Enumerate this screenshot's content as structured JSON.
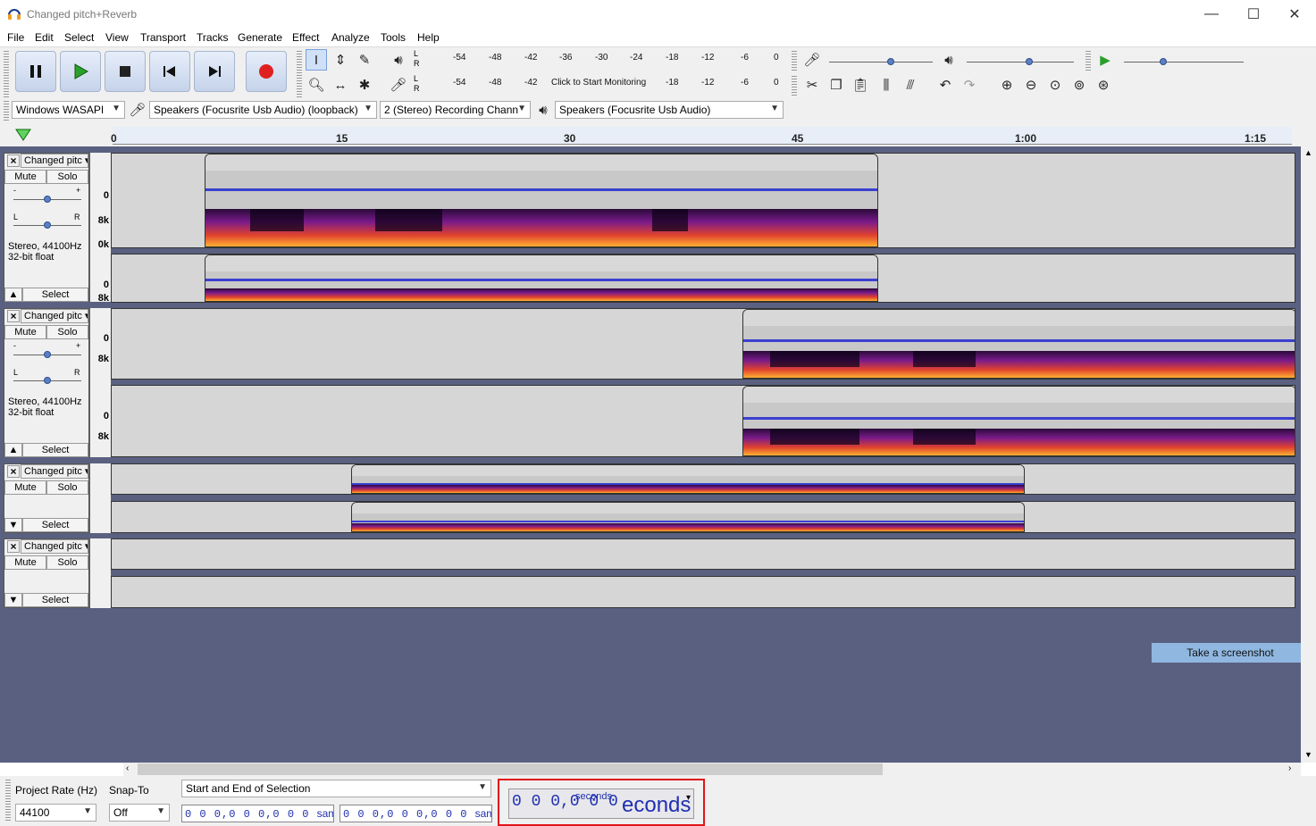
{
  "window": {
    "title": "Changed pitch+Reverb",
    "min": "—",
    "max": "☐",
    "close": "✕"
  },
  "menu": [
    "File",
    "Edit",
    "Select",
    "View",
    "Transport",
    "Tracks",
    "Generate",
    "Effect",
    "Analyze",
    "Tools",
    "Help"
  ],
  "meters": {
    "record_scale": [
      "-54",
      "-48",
      "-42",
      "-36",
      "-30",
      "-24",
      "-18",
      "-12",
      "-6",
      "0"
    ],
    "play_scale": [
      "-54",
      "-48",
      "-42",
      "Click to Start Monitoring",
      "-18",
      "-12",
      "-6",
      "0"
    ],
    "lr": [
      "L",
      "R"
    ]
  },
  "devices": {
    "host": "Windows WASAPI",
    "recording": "Speakers (Focusrite Usb Audio) (loopback)",
    "channels": "2 (Stereo) Recording Chann",
    "playback": "Speakers (Focusrite Usb Audio)"
  },
  "ruler": [
    "0",
    "15",
    "30",
    "45",
    "1:00",
    "1:15"
  ],
  "tracks": [
    {
      "name": "Changed pitc",
      "mute": "Mute",
      "solo": "Solo",
      "info1": "Stereo, 44100Hz",
      "info2": "32-bit float",
      "select": "Select",
      "gain_minus": "-",
      "gain_plus": "+",
      "pan_l": "L",
      "pan_r": "R",
      "v0": "0",
      "v8k": "8k",
      "v0k": "0k"
    },
    {
      "name": "Changed pitc",
      "mute": "Mute",
      "solo": "Solo",
      "info1": "Stereo, 44100Hz",
      "info2": "32-bit float",
      "select": "Select",
      "gain_minus": "-",
      "gain_plus": "+",
      "pan_l": "L",
      "pan_r": "R",
      "v0": "0",
      "v8k": "8k"
    },
    {
      "name": "Changed pitc",
      "mute": "Mute",
      "solo": "Solo",
      "select": "Select"
    },
    {
      "name": "Changed pitc",
      "mute": "Mute",
      "solo": "Solo",
      "select": "Select"
    }
  ],
  "screenshot_button": "Take a screenshot",
  "selection": {
    "rate_label": "Project Rate (Hz)",
    "rate_value": "44100",
    "snap_label": "Snap-To",
    "snap_value": "Off",
    "mode": "Start and End of Selection",
    "start": "0 0 0,0 0 0,0 0 0",
    "end": "0 0 0,0 0 0,0 0 0",
    "unit": "samples",
    "timer_small": "0 0 0,0 0 0",
    "timer_unit": "seconds",
    "timer_big": "econds"
  },
  "colors": {
    "wave": "#3a3fd0",
    "track_bg": "#5a6080",
    "highlight": "#e0151b"
  }
}
